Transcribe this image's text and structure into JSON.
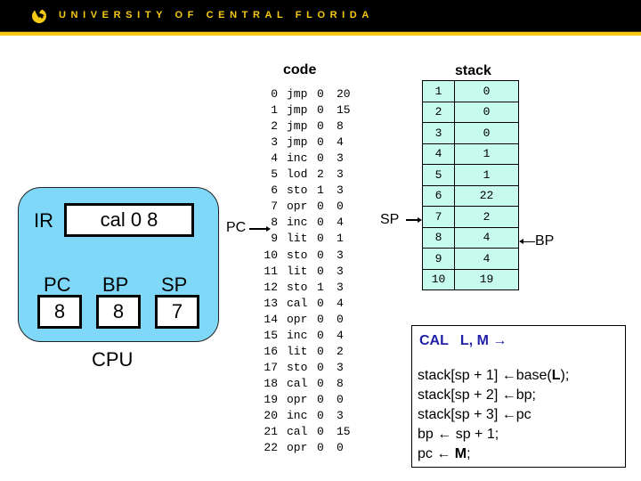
{
  "header": {
    "logo_icon": "ucf-pegasus-logo",
    "university": "UNIVERSITY OF CENTRAL FLORIDA",
    "colors": {
      "banner": "#000000",
      "gold": "#f6c915"
    }
  },
  "cpu": {
    "label": "CPU",
    "ir_label": "IR",
    "ir_value": "cal 0 8",
    "registers": [
      {
        "name": "PC",
        "value": "8"
      },
      {
        "name": "BP",
        "value": "8"
      },
      {
        "name": "SP",
        "value": "7"
      }
    ],
    "color": "#7fd8f8"
  },
  "code": {
    "title": "code",
    "pc_pointer_label": "PC",
    "pc_pointer_index": 8,
    "rows": [
      {
        "idx": "0",
        "op": "jmp",
        "l": "0",
        "m": "20"
      },
      {
        "idx": "1",
        "op": "jmp",
        "l": "0",
        "m": "15"
      },
      {
        "idx": "2",
        "op": "jmp",
        "l": "0",
        "m": "8"
      },
      {
        "idx": "3",
        "op": "jmp",
        "l": "0",
        "m": "4"
      },
      {
        "idx": "4",
        "op": "inc",
        "l": "0",
        "m": "3"
      },
      {
        "idx": "5",
        "op": "lod",
        "l": "2",
        "m": "3"
      },
      {
        "idx": "6",
        "op": "sto",
        "l": "1",
        "m": "3"
      },
      {
        "idx": "7",
        "op": "opr",
        "l": "0",
        "m": "0"
      },
      {
        "idx": "8",
        "op": "inc",
        "l": "0",
        "m": "4"
      },
      {
        "idx": "9",
        "op": "lit",
        "l": "0",
        "m": "1"
      },
      {
        "idx": "10",
        "op": "sto",
        "l": "0",
        "m": "3"
      },
      {
        "idx": "11",
        "op": "lit",
        "l": "0",
        "m": "3"
      },
      {
        "idx": "12",
        "op": "sto",
        "l": "1",
        "m": "3"
      },
      {
        "idx": "13",
        "op": "cal",
        "l": "0",
        "m": "4"
      },
      {
        "idx": "14",
        "op": "opr",
        "l": "0",
        "m": "0"
      },
      {
        "idx": "15",
        "op": "inc",
        "l": "0",
        "m": "4"
      },
      {
        "idx": "16",
        "op": "lit",
        "l": "0",
        "m": "2"
      },
      {
        "idx": "17",
        "op": "sto",
        "l": "0",
        "m": "3"
      },
      {
        "idx": "18",
        "op": "cal",
        "l": "0",
        "m": "8"
      },
      {
        "idx": "19",
        "op": "opr",
        "l": "0",
        "m": "0"
      },
      {
        "idx": "20",
        "op": "inc",
        "l": "0",
        "m": "3"
      },
      {
        "idx": "21",
        "op": "cal",
        "l": "0",
        "m": "15"
      },
      {
        "idx": "22",
        "op": "opr",
        "l": "0",
        "m": "0"
      }
    ]
  },
  "stack": {
    "title": "stack",
    "sp_pointer_label": "SP",
    "sp_pointer_index": 7,
    "bp_pointer_label": "BP",
    "bp_pointer_index": 8,
    "color": "#c6fbee",
    "rows": [
      {
        "idx": "1",
        "val": "0"
      },
      {
        "idx": "2",
        "val": "0"
      },
      {
        "idx": "3",
        "val": "0"
      },
      {
        "idx": "4",
        "val": "1"
      },
      {
        "idx": "5",
        "val": "1"
      },
      {
        "idx": "6",
        "val": "22"
      },
      {
        "idx": "7",
        "val": "2"
      },
      {
        "idx": "8",
        "val": "4"
      },
      {
        "idx": "9",
        "val": "4"
      },
      {
        "idx": "10",
        "val": "19"
      }
    ]
  },
  "instruction": {
    "title": "CAL   L, M →",
    "title_color": "#1f1fa8",
    "lines": [
      {
        "pre": "stack[sp + 1] ←base(",
        "bold": "L",
        "post": ");"
      },
      {
        "pre": "stack[sp + 2] ←bp;",
        "bold": "",
        "post": ""
      },
      {
        "pre": "stack[sp + 3] ←pc",
        "bold": "",
        "post": ""
      },
      {
        "pre": "bp ← sp + 1;",
        "bold": "",
        "post": ""
      },
      {
        "pre": "pc ← ",
        "bold": "M",
        "post": ";"
      }
    ]
  }
}
